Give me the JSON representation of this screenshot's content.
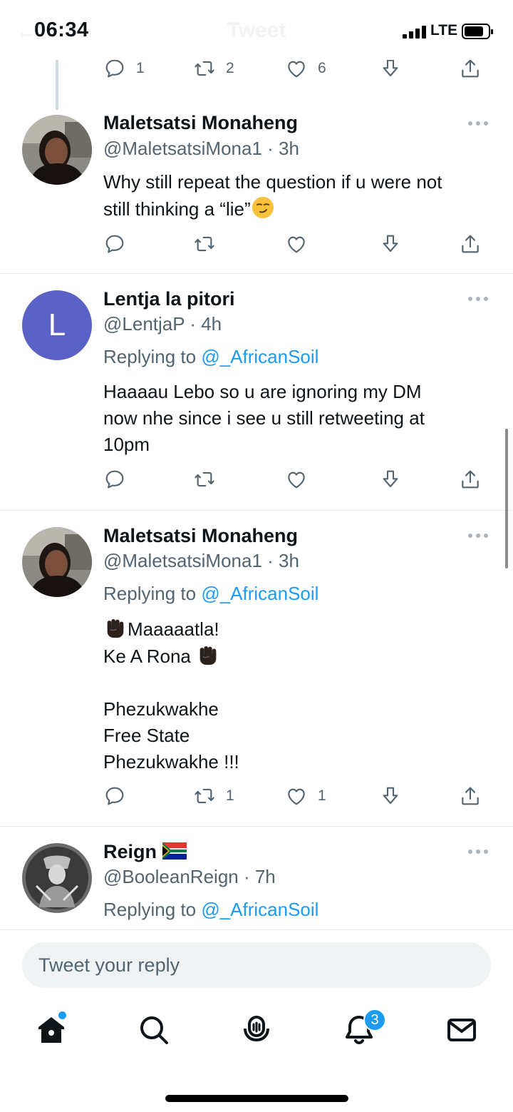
{
  "status_bar": {
    "time": "06:34",
    "network": "LTE",
    "header_title": "Tweet"
  },
  "top_action_row": {
    "reply_count": "1",
    "retweet_count": "2",
    "like_count": "6"
  },
  "tweets": [
    {
      "name": "Maletsatsi Monaheng",
      "handle": "@MaletsatsiMona1 · 3h",
      "text_line1": "Why still repeat the question if u were not",
      "text_line2": "still thinking a “lie”",
      "reply_count": "",
      "retweet_count": "",
      "like_count": ""
    },
    {
      "name": "Lentja la pitori",
      "handle": "@LentjaP · 4h",
      "avatar_letter": "L",
      "replying_prefix": "Replying to ",
      "replying_to": "@_AfricanSoil",
      "text_line1": "Haaaau Lebo so u are ignoring my DM",
      "text_line2": "now nhe since i see u still retweeting at",
      "text_line3": "10pm",
      "reply_count": "",
      "retweet_count": "",
      "like_count": ""
    },
    {
      "name": "Maletsatsi Monaheng",
      "handle": "@MaletsatsiMona1 · 3h",
      "replying_prefix": "Replying to ",
      "replying_to": "@_AfricanSoil",
      "text_line1": "Maaaaatla!",
      "text_line2": "Ke A Rona",
      "text_line3": "Phezukwakhe",
      "text_line4": "Free State",
      "text_line5": "Phezukwakhe !!!",
      "reply_count": "",
      "retweet_count": "1",
      "like_count": "1"
    },
    {
      "name": "Reign",
      "handle": "@BooleanReign · 7h",
      "replying_prefix": "Replying to ",
      "replying_to": "@_AfricanSoil"
    }
  ],
  "composer": {
    "placeholder": "Tweet your reply"
  },
  "tabbar": {
    "notifications_badge": "3"
  },
  "colors": {
    "accent": "#1d9bf0",
    "secondary_text": "#536471",
    "avatar_L": "#5b62c5"
  }
}
